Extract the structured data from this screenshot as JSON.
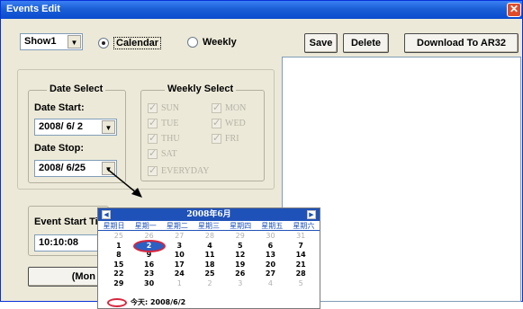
{
  "window": {
    "title": "Events Edit",
    "close_glyph": "✕"
  },
  "toolbar": {
    "show_select_value": "Show1",
    "radio_calendar": "Calendar",
    "radio_weekly": "Weekly",
    "calendar_selected": true,
    "save_label": "Save",
    "delete_label": "Delete",
    "download_label": "Download To AR32"
  },
  "date_select": {
    "group_title": "Date Select",
    "start_label": "Date Start:",
    "start_value": "2008/ 6/ 2",
    "stop_label": "Date Stop:",
    "stop_value": "2008/ 6/25"
  },
  "weekly_select": {
    "group_title": "Weekly Select",
    "days": [
      {
        "label": "SUN",
        "checked": true
      },
      {
        "label": "MON",
        "checked": true
      },
      {
        "label": "TUE",
        "checked": true
      },
      {
        "label": "WED",
        "checked": true
      },
      {
        "label": "THU",
        "checked": true
      },
      {
        "label": "FRI",
        "checked": true
      },
      {
        "label": "SAT",
        "checked": true
      }
    ],
    "everyday_label": "EVERYDAY"
  },
  "event_time": {
    "label": "Event Start Tim",
    "value": "10:10:08"
  },
  "bottom_button_label": "(Mon",
  "calendar": {
    "header": "2008年6月",
    "prev_glyph": "◀",
    "next_glyph": "▶",
    "weekdays": [
      "星期日",
      "星期一",
      "星期二",
      "星期三",
      "星期四",
      "星期五",
      "星期六"
    ],
    "weeks": [
      [
        "25",
        "26",
        "27",
        "28",
        "29",
        "30",
        "31"
      ],
      [
        "1",
        "2",
        "3",
        "4",
        "5",
        "6",
        "7"
      ],
      [
        "8",
        "9",
        "10",
        "11",
        "12",
        "13",
        "14"
      ],
      [
        "15",
        "16",
        "17",
        "18",
        "19",
        "20",
        "21"
      ],
      [
        "22",
        "23",
        "24",
        "25",
        "26",
        "27",
        "28"
      ],
      [
        "29",
        "30",
        "1",
        "2",
        "3",
        "4",
        "5"
      ]
    ],
    "selected_day": "2",
    "today_text": "今天: 2008/6/2"
  },
  "colors": {
    "title_bar": "#1b5fd6",
    "calendar_header": "#1f52b8",
    "highlight_ring": "#d7263d"
  }
}
